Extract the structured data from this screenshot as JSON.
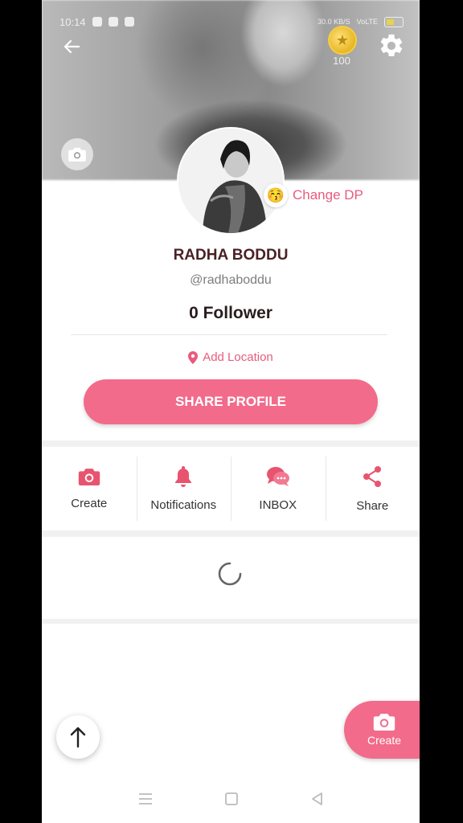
{
  "status_bar": {
    "time": "10:14",
    "net_speed": "30.0 KB/S",
    "carrier": "VoLTE"
  },
  "header": {
    "coin_count": "100"
  },
  "profile": {
    "change_dp_label": "Change DP",
    "name": "RADHA BODDU",
    "handle": "@radhaboddu",
    "followers": "0 Follower",
    "location_label": "Add Location",
    "share_profile_label": "SHARE PROFILE"
  },
  "actions": [
    {
      "label": "Create",
      "icon": "camera-icon"
    },
    {
      "label": "Notifications",
      "icon": "bell-icon"
    },
    {
      "label": "INBOX",
      "icon": "chat-bubbles-icon"
    },
    {
      "label": "Share",
      "icon": "share-icon"
    }
  ],
  "fab": {
    "create_label": "Create"
  },
  "colors": {
    "accent": "#f26b8a",
    "accent_text": "#e95b7d",
    "name_text": "#4a2125"
  }
}
